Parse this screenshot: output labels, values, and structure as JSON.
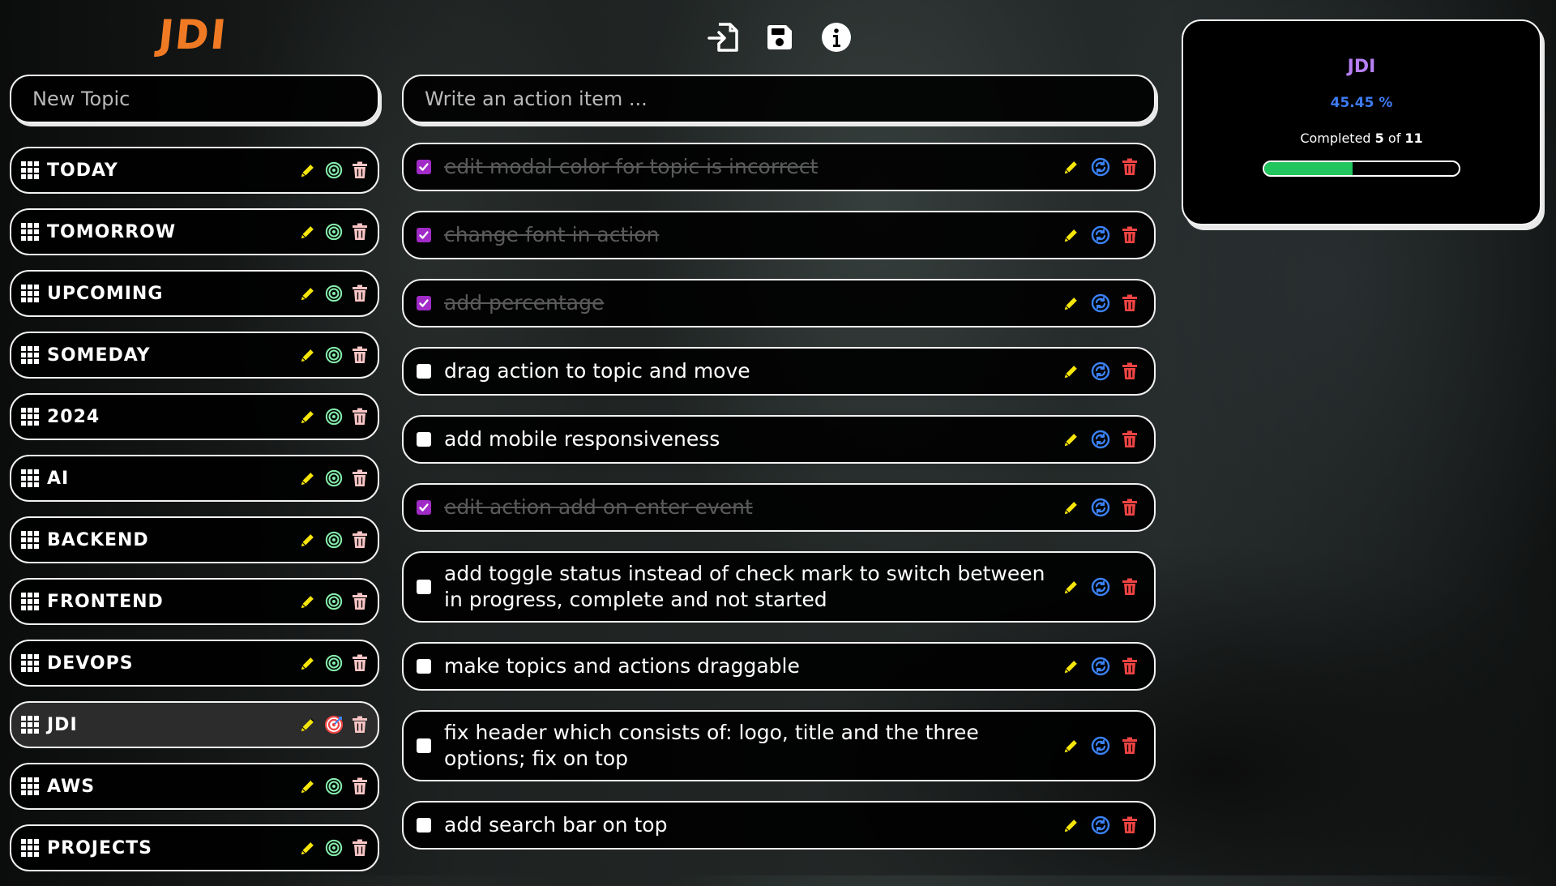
{
  "app": {
    "logo": "JDI"
  },
  "header": {
    "icons": [
      "import-icon",
      "save-icon",
      "info-icon"
    ]
  },
  "topic_input": {
    "placeholder": "New Topic"
  },
  "action_input": {
    "placeholder": "Write an action item ..."
  },
  "topics": [
    {
      "label": "TODAY"
    },
    {
      "label": "TOMORROW"
    },
    {
      "label": "UPCOMING"
    },
    {
      "label": "SOMEDAY"
    },
    {
      "label": "2024"
    },
    {
      "label": "AI"
    },
    {
      "label": "BACKEND"
    },
    {
      "label": "FRONTEND"
    },
    {
      "label": "DEVOPS"
    },
    {
      "label": "JDI",
      "selected": true
    },
    {
      "label": "AWS"
    },
    {
      "label": "PROJECTS"
    }
  ],
  "actions": [
    {
      "text": "edit modal color for topic is incorrect",
      "done": true
    },
    {
      "text": "change font in action",
      "done": true
    },
    {
      "text": "add percentage",
      "done": true
    },
    {
      "text": "drag action to topic and move",
      "done": false
    },
    {
      "text": "add mobile responsiveness",
      "done": false
    },
    {
      "text": "edit action add on enter event",
      "done": true
    },
    {
      "text": "add toggle status instead of check mark to switch between in progress, complete and not started",
      "done": false
    },
    {
      "text": "make topics and actions draggable",
      "done": false
    },
    {
      "text": "fix header which consists of: logo, title and the three options; fix on top",
      "done": false
    },
    {
      "text": "add search bar on top",
      "done": false
    }
  ],
  "stats": {
    "title": "JDI",
    "percentage": "45.45 %",
    "completed_prefix": "Completed",
    "completed_count": "5",
    "of": "of",
    "total": "11",
    "progress": 0.4545
  },
  "colors": {
    "accent_logo": "#f07a24",
    "checked": "#a12bc7",
    "edit": "#f5e50a",
    "target": "#86efac",
    "target_selected": "#ef4444",
    "refresh": "#3b82f6",
    "delete_topic": "#f9c5c5",
    "delete_action": "#ef4444",
    "progress_fill": "#22c55e"
  }
}
